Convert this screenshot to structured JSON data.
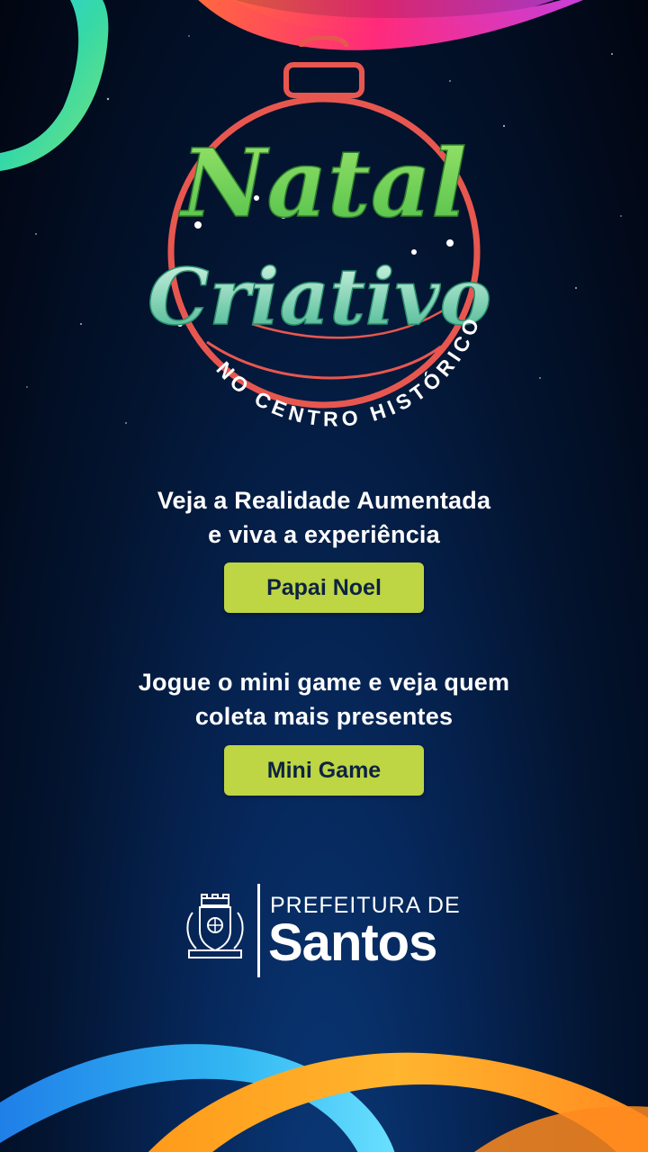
{
  "logo": {
    "line1": "Natal",
    "line2": "Criativo",
    "arc_text": "NO CENTRO HISTÓRICO"
  },
  "ar_section": {
    "line1": "Veja a Realidade Aumentada",
    "line2": "e viva a experiência",
    "button_label": "Papai Noel"
  },
  "game_section": {
    "line1": "Jogue o mini game e veja quem",
    "line2": "coleta mais presentes",
    "button_label": "Mini Game"
  },
  "footer": {
    "prefecture_label": "PREFEITURA DE",
    "city_label": "Santos"
  },
  "colors": {
    "button_bg": "#bed544",
    "button_text": "#0c2342",
    "ornament_red": "#e8574f",
    "script_green": "#7ed957"
  },
  "icons": {
    "crest": "city-crest-icon",
    "ornament": "christmas-ornament-icon"
  }
}
